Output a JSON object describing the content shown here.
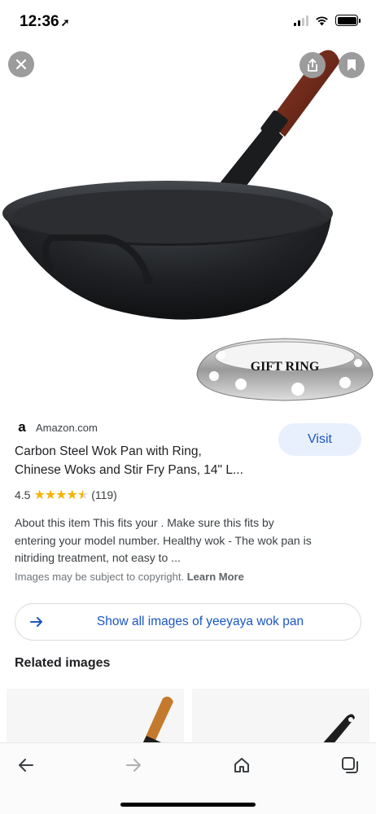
{
  "status_bar": {
    "time": "12:36",
    "location_arrow": "location-arrow-icon"
  },
  "hero": {
    "close_icon": "close-icon",
    "share_icon": "share-icon",
    "bookmark_icon": "bookmark-icon",
    "badge_text": "GIFT RING"
  },
  "result": {
    "source": "Amazon.com",
    "source_logo": "a",
    "visit_label": "Visit",
    "title_line1": "Carbon Steel Wok Pan with Ring,",
    "title_line2": "Chinese Woks and Stir Fry Pans, 14\" L...",
    "rating_value": "4.5",
    "rating_stars": 4.5,
    "review_count": "(119)",
    "desc_line1": "About this item This fits your . Make sure this fits by",
    "desc_line2": "entering your model number. Healthy wok - The wok pan is",
    "desc_line3": "nitriding treatment, not easy to ...",
    "copyright_text": "Images may be subject to copyright.",
    "learn_more": "Learn More"
  },
  "show_all": {
    "label": "Show all images of yeeyaya wok pan"
  },
  "related": {
    "title": "Related images"
  },
  "bottom_nav": {
    "back": "back-arrow-icon",
    "forward": "forward-arrow-icon",
    "home": "home-icon",
    "tabs": "tabs-icon"
  },
  "colors": {
    "link_blue": "#1a56c4",
    "visit_bg": "#e8f0fe",
    "star": "#f4b400"
  }
}
